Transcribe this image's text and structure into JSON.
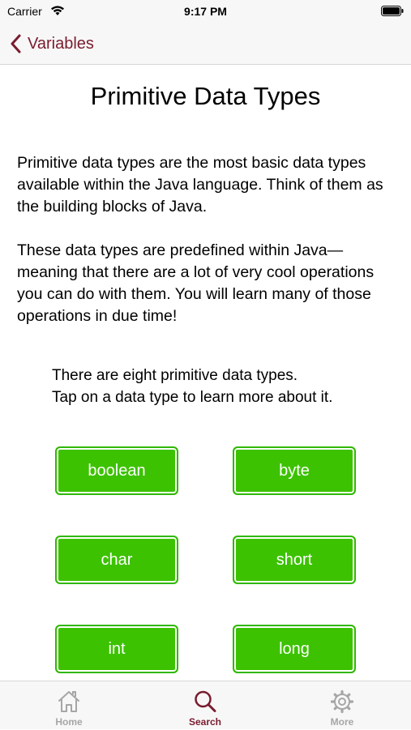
{
  "status_bar": {
    "carrier": "Carrier",
    "time": "9:17 PM"
  },
  "nav": {
    "back_label": "Variables"
  },
  "page": {
    "title": "Primitive Data Types",
    "paragraph_1": "Primitive data types are the most basic data types available within the Java language. Think of them as the building blocks of Java.",
    "paragraph_2": "These data types are predefined within Java—meaning that there are a lot of very cool operations you can do with them. You will learn many of those operations in due time!",
    "instructions_line_1": "There are eight primitive data types.",
    "instructions_line_2": "Tap on a data type to learn more about it."
  },
  "type_buttons": [
    "boolean",
    "byte",
    "char",
    "short",
    "int",
    "long"
  ],
  "tabs": [
    {
      "label": "Home",
      "icon": "home-icon",
      "active": false
    },
    {
      "label": "Search",
      "icon": "search-icon",
      "active": true
    },
    {
      "label": "More",
      "icon": "gear-icon",
      "active": false
    }
  ],
  "colors": {
    "accent": "#7a1c2e",
    "button_green": "#3cc200",
    "tab_inactive": "#a6a6a6"
  }
}
